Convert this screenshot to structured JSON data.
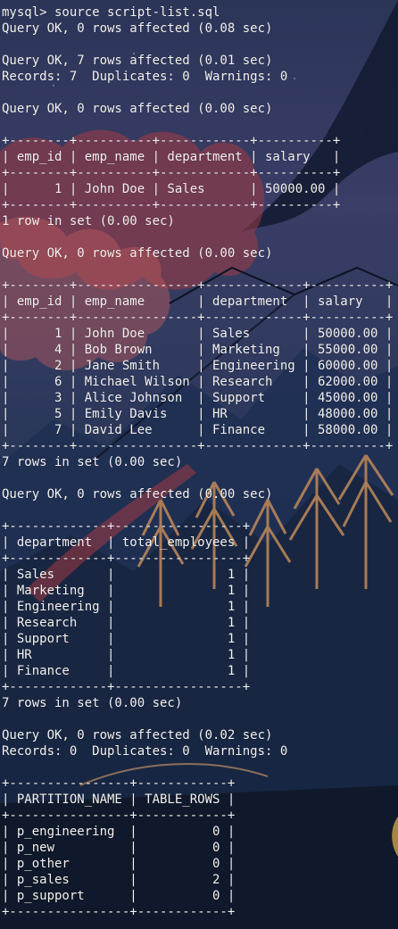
{
  "terminal": {
    "lines": [
      "mysql> source script-list.sql",
      "Query OK, 0 rows affected (0.08 sec)",
      "",
      "Query OK, 7 rows affected (0.01 sec)",
      "Records: 7  Duplicates: 0  Warnings: 0",
      "",
      "Query OK, 0 rows affected (0.00 sec)",
      "",
      "+--------+----------+------------+----------+",
      "| emp_id | emp_name | department | salary   |",
      "+--------+----------+------------+----------+",
      "|      1 | John Doe | Sales      | 50000.00 |",
      "+--------+----------+------------+----------+",
      "1 row in set (0.00 sec)",
      "",
      "Query OK, 0 rows affected (0.00 sec)",
      "",
      "+--------+----------------+-------------+----------+",
      "| emp_id | emp_name       | department  | salary   |",
      "+--------+----------------+-------------+----------+",
      "|      1 | John Doe       | Sales       | 50000.00 |",
      "|      4 | Bob Brown      | Marketing   | 55000.00 |",
      "|      2 | Jane Smith     | Engineering | 60000.00 |",
      "|      6 | Michael Wilson | Research    | 62000.00 |",
      "|      3 | Alice Johnson  | Support     | 45000.00 |",
      "|      5 | Emily Davis    | HR          | 48000.00 |",
      "|      7 | David Lee      | Finance     | 58000.00 |",
      "+--------+----------------+-------------+----------+",
      "7 rows in set (0.00 sec)",
      "",
      "Query OK, 0 rows affected (0.00 sec)",
      "",
      "+-------------+-----------------+",
      "| department  | total_employees |",
      "+-------------+-----------------+",
      "| Sales       |               1 |",
      "| Marketing   |               1 |",
      "| Engineering |               1 |",
      "| Research    |               1 |",
      "| Support     |               1 |",
      "| HR          |               1 |",
      "| Finance     |               1 |",
      "+-------------+-----------------+",
      "7 rows in set (0.00 sec)",
      "",
      "Query OK, 0 rows affected (0.02 sec)",
      "Records: 0  Duplicates: 0  Warnings: 0",
      "",
      "+----------------+------------+",
      "| PARTITION_NAME | TABLE_ROWS |",
      "+----------------+------------+",
      "| p_engineering  |          0 |",
      "| p_new          |          0 |",
      "| p_other        |          0 |",
      "| p_sales        |          2 |",
      "| p_support      |          0 |",
      "+----------------+------------+",
      ""
    ]
  },
  "colors": {
    "text": "#f3f1ee",
    "sky_top": "#2b3558",
    "sky_bottom": "#141f33",
    "cloud_red": "#a33a44",
    "cloud_pink": "#d97a72",
    "mountain": "#1b2b4a",
    "tree": "#c08a5a"
  }
}
